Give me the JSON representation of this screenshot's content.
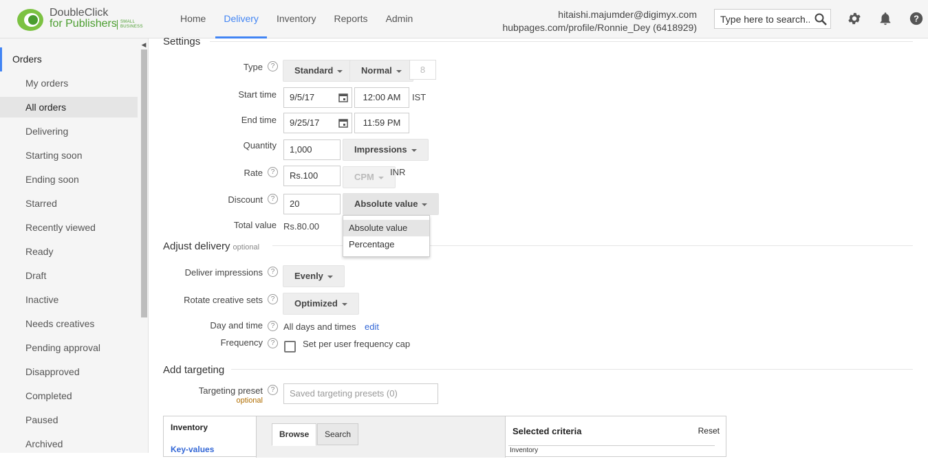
{
  "header": {
    "logo_line1": "DoubleClick",
    "logo_line2": "for Publishers",
    "logo_small": "SMALL BUSINESS",
    "nav": [
      "Home",
      "Delivery",
      "Inventory",
      "Reports",
      "Admin"
    ],
    "active_nav": "Delivery",
    "account_email": "hitaishi.majumder@digimyx.com",
    "account_network": "hubpages.com/profile/Ronnie_Dey (6418929)",
    "search_placeholder": "Type here to search...",
    "accent_color": "#4285f4"
  },
  "sidebar": {
    "heading": "Orders",
    "items": [
      "My orders",
      "All orders",
      "Delivering",
      "Starting soon",
      "Ending soon",
      "Starred",
      "Recently viewed",
      "Ready",
      "Draft",
      "Inactive",
      "Needs creatives",
      "Pending approval",
      "Disapproved",
      "Completed",
      "Paused",
      "Archived"
    ],
    "active_item": "All orders"
  },
  "settings": {
    "title": "Settings",
    "type_label": "Type",
    "type_value": "Standard",
    "priority_value": "Normal",
    "priority_number": "8",
    "start_label": "Start time",
    "start_date": "9/5/17",
    "start_time": "12:00 AM",
    "timezone": "IST",
    "end_label": "End time",
    "end_date": "9/25/17",
    "end_time": "11:59 PM",
    "quantity_label": "Quantity",
    "quantity_value": "1,000",
    "quantity_unit": "Impressions",
    "rate_label": "Rate",
    "rate_value": "Rs.100",
    "rate_unit": "CPM",
    "currency": "INR",
    "discount_label": "Discount",
    "discount_value": "20",
    "discount_type": "Absolute value",
    "discount_options": [
      "Absolute value",
      "Percentage"
    ],
    "total_label": "Total value",
    "total_value": "Rs.80.00"
  },
  "adjust": {
    "title": "Adjust delivery",
    "optional": "optional",
    "deliver_label": "Deliver impressions",
    "deliver_value": "Evenly",
    "rotate_label": "Rotate creative sets",
    "rotate_value": "Optimized",
    "daytime_label": "Day and time",
    "daytime_value": "All days and times",
    "edit_link": "edit",
    "frequency_label": "Frequency",
    "frequency_checkbox": "Set per user frequency cap"
  },
  "targeting": {
    "title": "Add targeting",
    "preset_label": "Targeting preset",
    "preset_optional": "optional",
    "preset_placeholder": "Saved targeting presets (0)",
    "left_items": [
      "Inventory",
      "Key-values"
    ],
    "tabs": [
      "Browse",
      "Search"
    ],
    "selected_title": "Selected criteria",
    "reset": "Reset",
    "selected_sub": "Inventory"
  },
  "help_glyph": "?"
}
